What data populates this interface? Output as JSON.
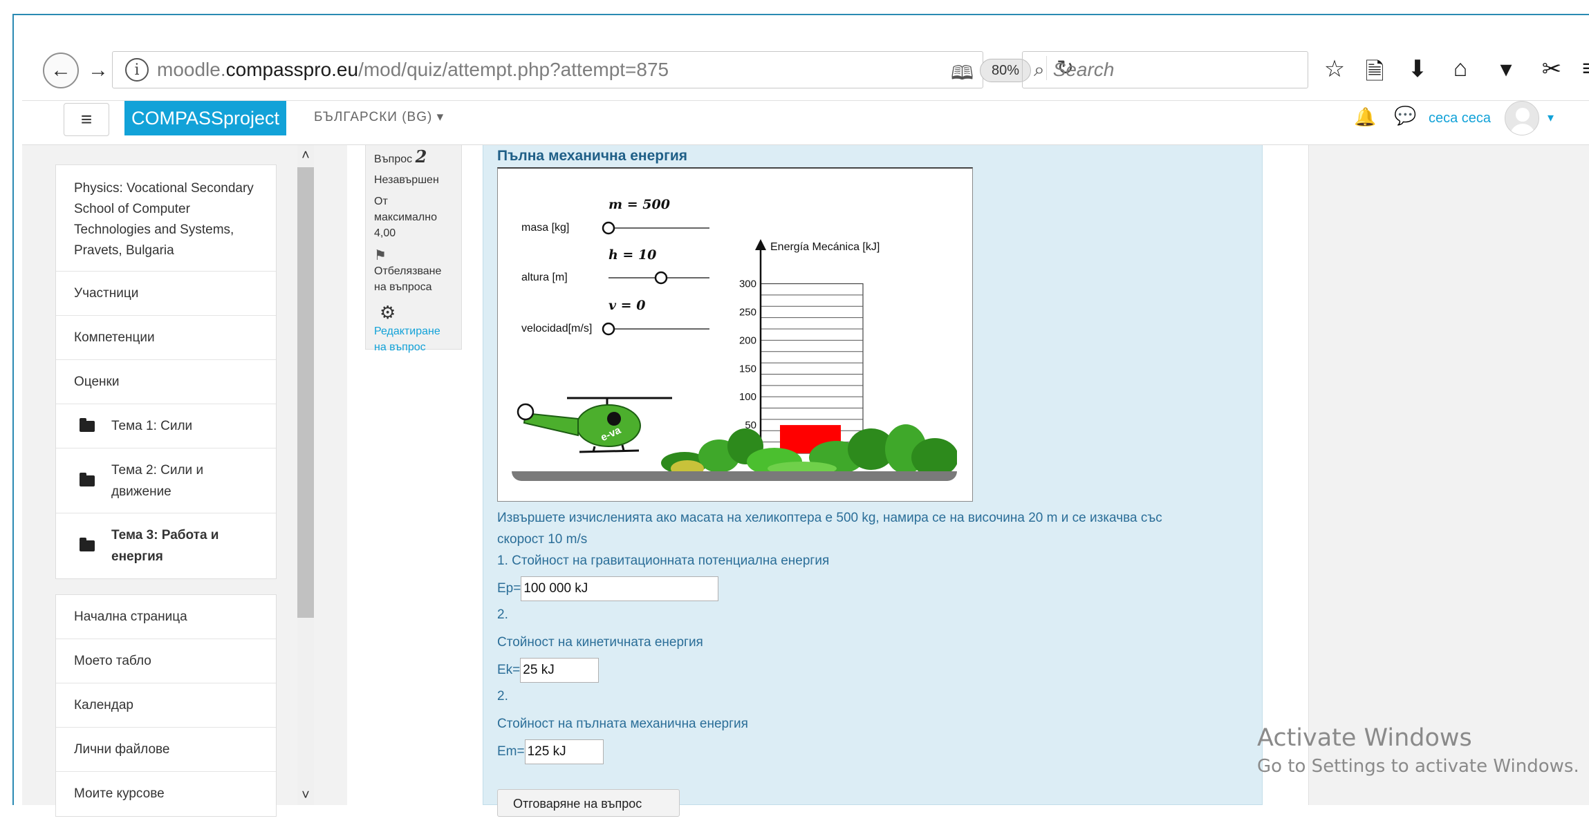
{
  "browser": {
    "url_prefix": "moodle.",
    "url_domain": "compasspro.eu",
    "url_path": "/mod/quiz/attempt.php?attempt=875",
    "zoom": "80%",
    "search_placeholder": "Search"
  },
  "navbar": {
    "brand": "COMPASSproject",
    "language": "БЪЛГАРСКИ (BG)",
    "username": "ceca ceca"
  },
  "sidebar": {
    "course": "Physics: Vocational Secondary School of Computer Technologies and Systems, Pravets, Bulgaria",
    "items": [
      "Участници",
      "Компетенции",
      "Оценки"
    ],
    "topics": [
      "Тема 1: Сили",
      "Тема 2: Сили и движение",
      "Тема 3: Работа и енергия"
    ],
    "nav": [
      "Начална страница",
      "Моето табло",
      "Календар",
      "Лични файлове",
      "Моите курсове"
    ]
  },
  "question_info": {
    "label": "Въпрос",
    "number": "2",
    "status": "Незавършен",
    "max_grade": "От максимално 4,00",
    "flag": "Отбелязване на въпроса",
    "edit": "Редактиране на въпрос"
  },
  "question": {
    "title": "Пълна механична енергия",
    "text_line1": "Извършете изчисленията ако масата на хеликоптера е 500 kg, намира се на височина 20 m и се изкачва със",
    "text_line2": "скорост 10 m/s",
    "item1": "1. Стойност на гравитационната потенциална енергия",
    "ep_label": "Ep=",
    "ep_value": "100 000 kJ",
    "num2a": "2.",
    "item2": "Стойност на кинетичната енергия",
    "ek_label": "Ek=",
    "ek_value": "25 kJ",
    "num2b": "2.",
    "item3": "Стойност на пълната механична енергия",
    "em_label": "Em=",
    "em_value": "125 kJ",
    "check_button": "Отговаряне на въпрос"
  },
  "applet": {
    "m_label": "m = 500",
    "mass_label": "masa [kg]",
    "h_label": "h = 10",
    "height_label": "altura [m]",
    "v_label": "v = 0",
    "velocity_label": "velocidad[m/s]",
    "energy_label": "Energía Mecánica [kJ]",
    "ticks": [
      "300",
      "250",
      "200",
      "150",
      "100",
      "50"
    ],
    "heli_text": "e-va",
    "energy_value": 50
  },
  "watermark": {
    "line1": "Activate Windows",
    "line2": "Go to Settings to activate Windows."
  }
}
